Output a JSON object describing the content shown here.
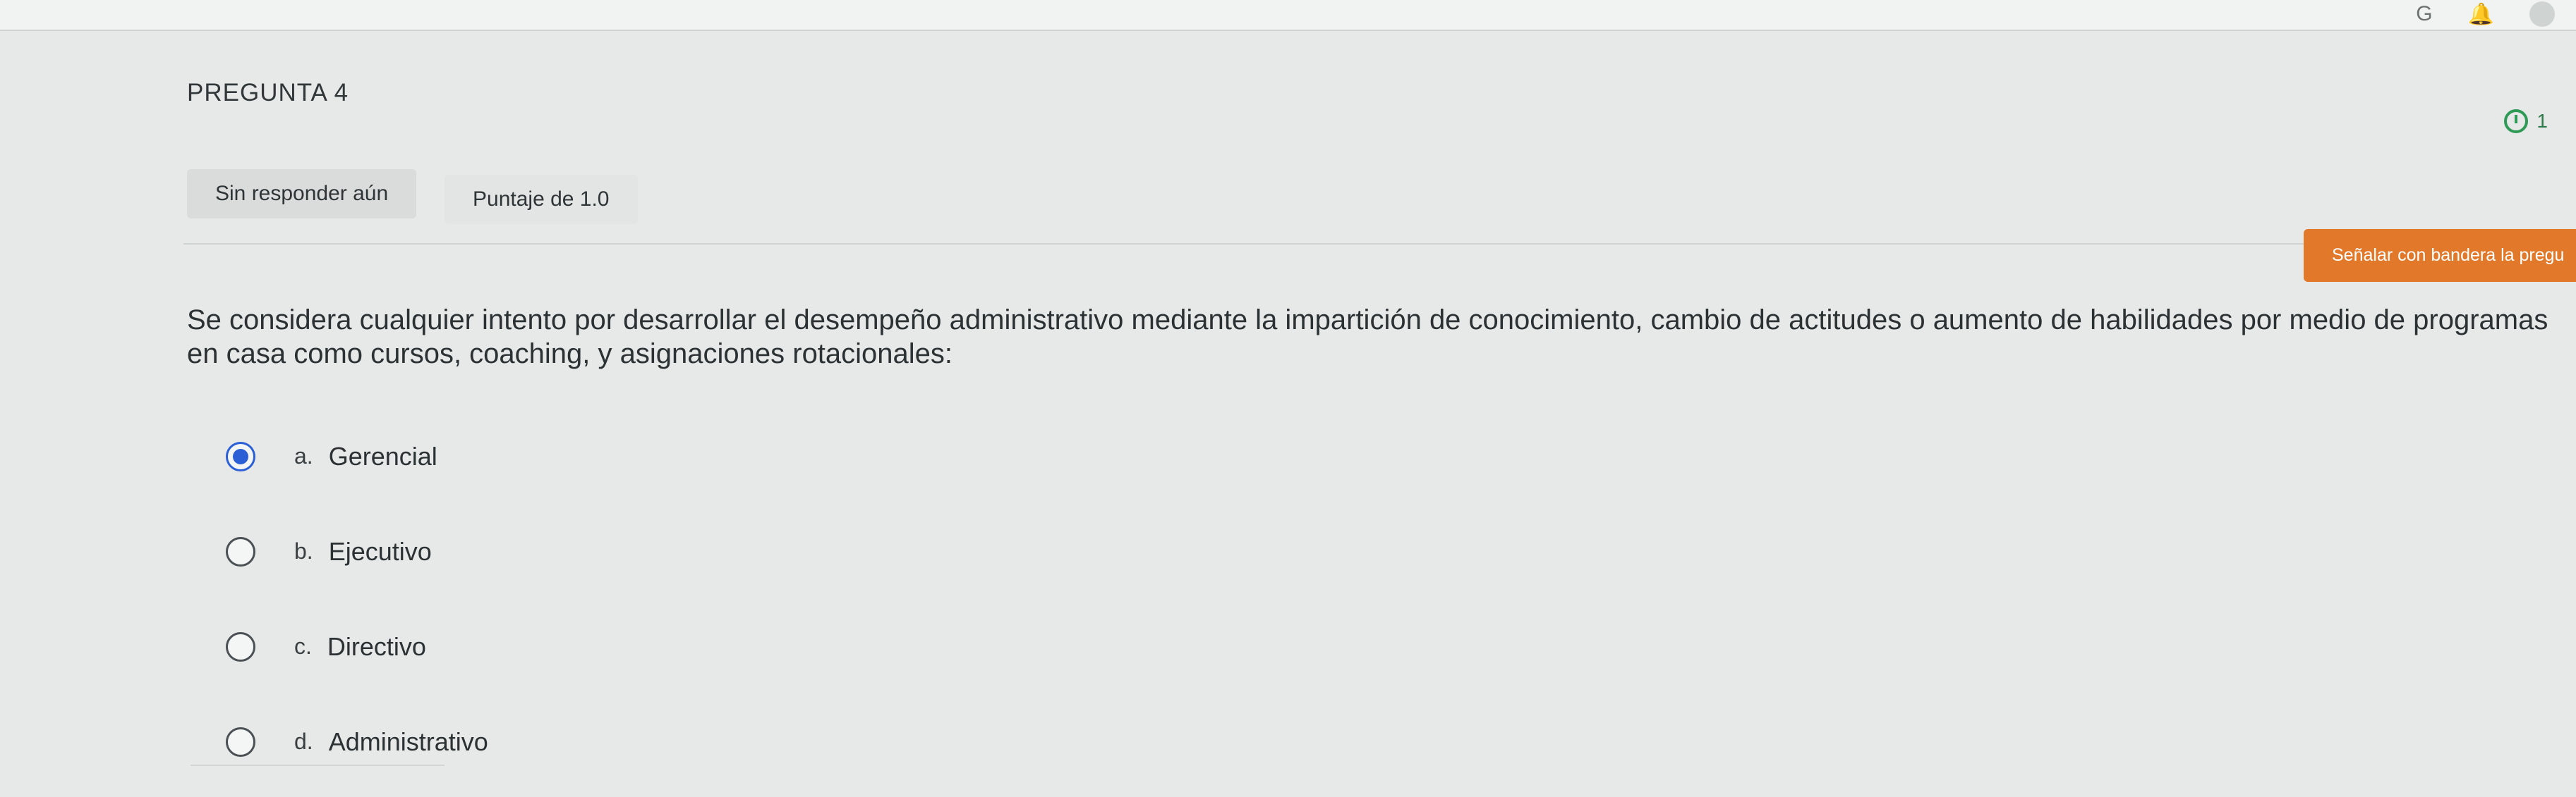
{
  "question": {
    "number_label": "PREGUNTA 4",
    "status": "Sin responder aún",
    "points": "Puntaje de 1.0",
    "flag_label": "Señalar con bandera la pregu",
    "timer_label": "1",
    "text": "Se considera cualquier intento por desarrollar el desempeño administrativo mediante la impartición de conocimiento, cambio de actitudes o aumento de habilidades por medio de programas en casa como cursos, coaching, y asignaciones rotacionales:"
  },
  "options": [
    {
      "letter": "a.",
      "text": "Gerencial",
      "selected": true
    },
    {
      "letter": "b.",
      "text": "Ejecutivo",
      "selected": false
    },
    {
      "letter": "c.",
      "text": "Directivo",
      "selected": false
    },
    {
      "letter": "d.",
      "text": "Administrativo",
      "selected": false
    }
  ],
  "topbar": {
    "icon1": "G",
    "icon2": "bell-icon"
  },
  "colors": {
    "flag": "#e2782a",
    "radio_selected": "#2b5fd6",
    "timer": "#2f9a55"
  }
}
